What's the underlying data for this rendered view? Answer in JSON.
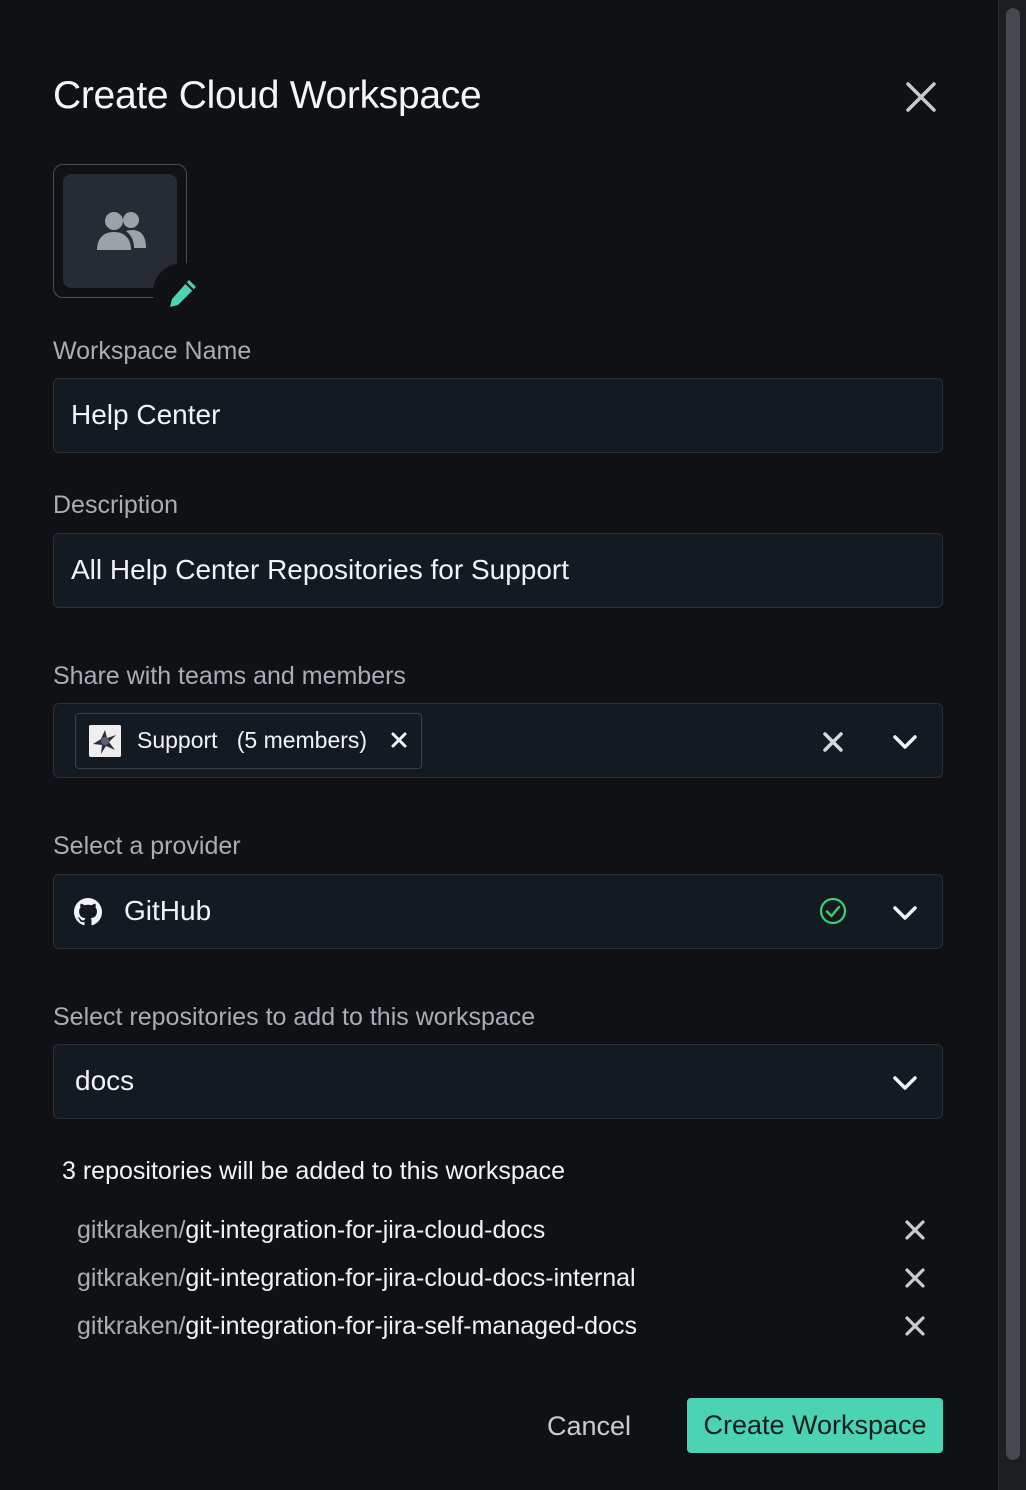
{
  "dialog": {
    "title": "Create Cloud Workspace"
  },
  "icons": {
    "close": "close-icon",
    "avatar": "users-icon",
    "edit": "pencil-icon",
    "github": "github-icon",
    "check": "check-circle-icon",
    "chevron": "chevron-down-icon",
    "remove": "x-icon"
  },
  "workspace_name": {
    "label": "Workspace Name",
    "value": "Help Center"
  },
  "description": {
    "label": "Description",
    "value": "All Help Center Repositories for Support"
  },
  "share": {
    "label": "Share with teams and members",
    "chips": [
      {
        "name": "Support",
        "members": "(5 members)"
      }
    ]
  },
  "provider": {
    "label": "Select a provider",
    "value": "GitHub"
  },
  "repositories": {
    "label": "Select repositories to add to this workspace",
    "search_value": "docs",
    "summary": "3 repositories will be added to this workspace",
    "items": [
      {
        "owner": "gitkraken/",
        "name": "git-integration-for-jira-cloud-docs"
      },
      {
        "owner": "gitkraken/",
        "name": "git-integration-for-jira-cloud-docs-internal"
      },
      {
        "owner": "gitkraken/",
        "name": "git-integration-for-jira-self-managed-docs"
      }
    ]
  },
  "actions": {
    "cancel": "Cancel",
    "create": "Create Workspace"
  },
  "colors": {
    "accent": "#4cd3b3",
    "background": "#0f1115",
    "field": "#141a22",
    "success": "#3ecf6e"
  }
}
